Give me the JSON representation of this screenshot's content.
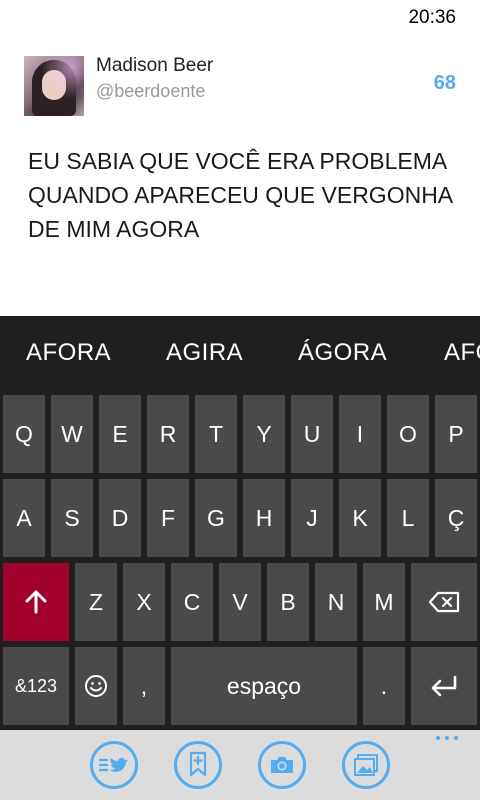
{
  "status": {
    "time": "20:36"
  },
  "user": {
    "name": "Madison Beer",
    "handle": "@beerdoente"
  },
  "compose": {
    "char_count": "68",
    "text": "EU SABIA QUE VOCÊ ERA PROBLEMA QUANDO APARECEU QUE VERGONHA DE MIM AGORA"
  },
  "keyboard": {
    "suggestions": [
      "AFORA",
      "AGIRA",
      "ÁGORA",
      "AFO"
    ],
    "row1": [
      "Q",
      "W",
      "E",
      "R",
      "T",
      "Y",
      "U",
      "I",
      "O",
      "P"
    ],
    "row2": [
      "A",
      "S",
      "D",
      "F",
      "G",
      "H",
      "J",
      "K",
      "L",
      "Ç"
    ],
    "row3": [
      "Z",
      "X",
      "C",
      "V",
      "B",
      "N",
      "M"
    ],
    "symbols_label": "&123",
    "comma_label": ",",
    "space_label": "espaço",
    "period_label": ".",
    "shift_icon": "shift-arrow-icon",
    "backspace_icon": "backspace-icon",
    "enter_icon": "enter-icon",
    "emoji_icon": "smiley-icon"
  },
  "appbar": {
    "buttons": [
      "send-tweet-icon",
      "attach-location-icon",
      "camera-icon",
      "gallery-icon"
    ]
  },
  "colors": {
    "accent": "#55acee",
    "shift": "#a2002d",
    "key": "#4a4a4a",
    "keyboard_bg": "#1f1f1f"
  }
}
